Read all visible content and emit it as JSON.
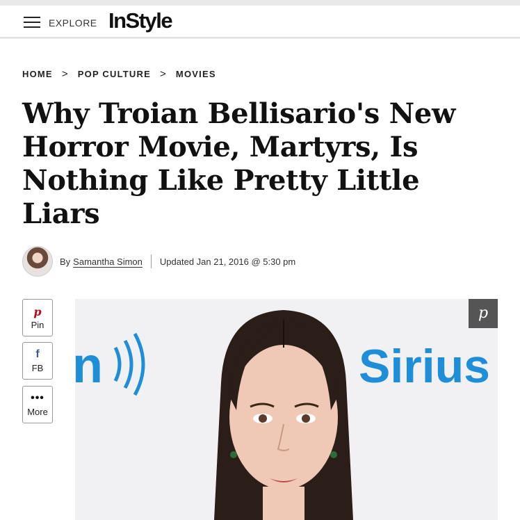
{
  "header": {
    "explore_label": "EXPLORE",
    "logo": "InStyle"
  },
  "breadcrumb": {
    "items": [
      "HOME",
      "POP CULTURE",
      "MOVIES"
    ],
    "separator": ">"
  },
  "article": {
    "headline": "Why Troian Bellisario's New Horror Movie, Martyrs, Is Nothing Like Pretty Little Liars",
    "by_prefix": "By",
    "author": "Samantha Simon",
    "updated": "Updated Jan 21, 2016 @ 5:30 pm"
  },
  "share": {
    "pin_label": "Pin",
    "fb_label": "FB",
    "more_label": "More"
  },
  "hero": {
    "backdrop_text_left": "n",
    "backdrop_text_right": "Sirius"
  },
  "colors": {
    "pinterest": "#bd081c",
    "facebook": "#3b5998",
    "sirius_blue": "#1f8ed8"
  }
}
